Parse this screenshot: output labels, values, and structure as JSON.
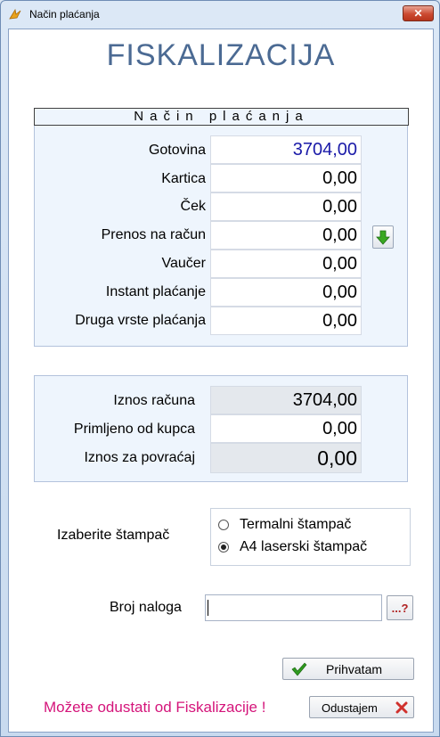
{
  "window": {
    "title": "Način plaćanja",
    "close_label": "✕"
  },
  "heading": "FISKALIZACIJA",
  "payment": {
    "header": "Način plaćanja",
    "rows": [
      {
        "label": "Gotovina",
        "value": "3704,00"
      },
      {
        "label": "Kartica",
        "value": "0,00"
      },
      {
        "label": "Ček",
        "value": "0,00"
      },
      {
        "label": "Prenos na račun",
        "value": "0,00"
      },
      {
        "label": "Vaučer",
        "value": "0,00"
      },
      {
        "label": "Instant plaćanje",
        "value": "0,00"
      },
      {
        "label": "Druga vrste plaćanja",
        "value": "0,00"
      }
    ]
  },
  "totals": {
    "rows": [
      {
        "label": "Iznos računa",
        "value": "3704,00"
      },
      {
        "label": "Primljeno od kupca",
        "value": "0,00"
      },
      {
        "label": "Iznos za povraćaj",
        "value": "0,00"
      }
    ]
  },
  "printer": {
    "label": "Izaberite štampač",
    "options": [
      {
        "label": "Termalni štampač",
        "selected": false
      },
      {
        "label": "A4 laserski štampač",
        "selected": true
      }
    ]
  },
  "order": {
    "label": "Broj naloga",
    "value": "",
    "lookup_label": "...?"
  },
  "buttons": {
    "accept": "Prihvatam",
    "cancel": "Odustajem"
  },
  "cancel_note": "Možete odustati od Fiskalizacije !",
  "colors": {
    "heading": "#4b6a93",
    "cash_value": "#1a1aa8",
    "note": "#d4147a",
    "accept_check": "#2e9a1e",
    "cancel_x": "#d0312d"
  }
}
